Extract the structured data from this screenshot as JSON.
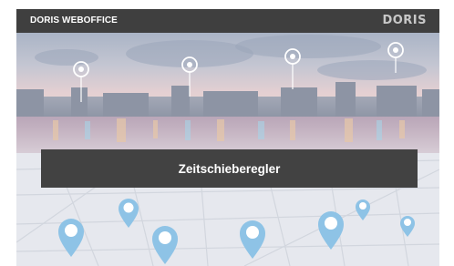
{
  "app": {
    "title": "DORIS WEBOFFICE",
    "logo_text": "DORIS"
  },
  "hero": {
    "banner_label": "Zeitschieberegler"
  },
  "colors": {
    "topbar": "#3f3f3f",
    "banner": "#424242",
    "map_pin": "#8ec3e6",
    "skyline_pin": "#ffffff"
  },
  "icons": {
    "skyline_pins": [
      "location-pin-icon",
      "location-pin-icon",
      "location-pin-icon",
      "location-pin-icon"
    ],
    "map_pins": [
      "map-pin-icon",
      "map-pin-icon",
      "map-pin-icon",
      "map-pin-icon",
      "map-pin-icon",
      "map-pin-icon",
      "map-pin-icon"
    ]
  }
}
